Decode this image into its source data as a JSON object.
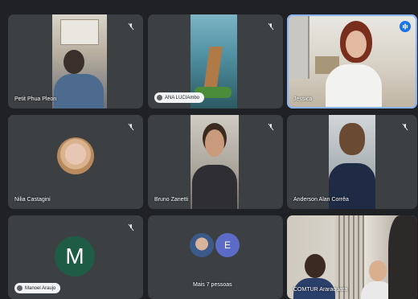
{
  "participants": [
    {
      "name": "Petit Phua Pleon",
      "muted": true
    },
    {
      "name": "ANA LUCIAmbo",
      "muted": true
    },
    {
      "name": "Jessica",
      "muted": false,
      "speaking": true
    },
    {
      "name": "Nilia Castagini",
      "muted": true
    },
    {
      "name": "Bruno Zanetti",
      "muted": true
    },
    {
      "name": "Anderson Alan Corrêa",
      "muted": true
    },
    {
      "name": "Manoel Araujo",
      "muted": true,
      "avatar_letter": "M",
      "avatar_color": "#1e5c45"
    },
    {
      "name": "Mais 7 pessoas",
      "muted": true,
      "extra_avatar_letter": "E",
      "extra_avatar_color": "#5b6bc6"
    },
    {
      "name": "COMTUR Araraquara",
      "muted": false
    }
  ],
  "colors": {
    "background": "#202124",
    "tile": "#3c4043",
    "accent": "#8ab4f8",
    "speaking": "#1a73e8"
  }
}
